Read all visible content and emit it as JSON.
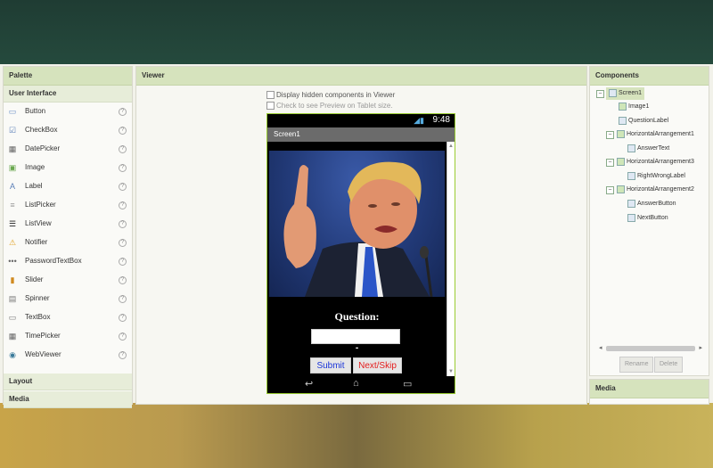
{
  "palette": {
    "header": "Palette",
    "section_user_interface": "User Interface",
    "items": [
      {
        "label": "Button",
        "icon": "button-icon",
        "glyph": "▭",
        "color": "#6a8fc7"
      },
      {
        "label": "CheckBox",
        "icon": "checkbox-icon",
        "glyph": "☑",
        "color": "#5a7fb7"
      },
      {
        "label": "DatePicker",
        "icon": "datepicker-icon",
        "glyph": "▦",
        "color": "#666"
      },
      {
        "label": "Image",
        "icon": "image-icon",
        "glyph": "▣",
        "color": "#6aa84f"
      },
      {
        "label": "Label",
        "icon": "label-icon",
        "glyph": "A",
        "color": "#5a7fb7"
      },
      {
        "label": "ListPicker",
        "icon": "listpicker-icon",
        "glyph": "≡",
        "color": "#999"
      },
      {
        "label": "ListView",
        "icon": "listview-icon",
        "glyph": "☰",
        "color": "#222"
      },
      {
        "label": "Notifier",
        "icon": "notifier-icon",
        "glyph": "⚠",
        "color": "#e0a020"
      },
      {
        "label": "PasswordTextBox",
        "icon": "password-icon",
        "glyph": "•••",
        "color": "#666"
      },
      {
        "label": "Slider",
        "icon": "slider-icon",
        "glyph": "▮",
        "color": "#d08a20"
      },
      {
        "label": "Spinner",
        "icon": "spinner-icon",
        "glyph": "▤",
        "color": "#777"
      },
      {
        "label": "TextBox",
        "icon": "textbox-icon",
        "glyph": "▭",
        "color": "#777"
      },
      {
        "label": "TimePicker",
        "icon": "timepicker-icon",
        "glyph": "▦",
        "color": "#666"
      },
      {
        "label": "WebViewer",
        "icon": "webviewer-icon",
        "glyph": "◉",
        "color": "#3a7a9a"
      }
    ],
    "section_layout": "Layout",
    "section_media": "Media"
  },
  "viewer": {
    "header": "Viewer",
    "display_hidden": "Display hidden components in Viewer",
    "tablet_preview": "Check to see Preview on Tablet size."
  },
  "phone": {
    "time": "9:48",
    "screen_title": "Screen1",
    "question_label": "Question:",
    "answer_value": "",
    "right_wrong_label": "-",
    "submit_label": "Submit",
    "next_label": "Next/Skip"
  },
  "components": {
    "header": "Components",
    "tree": [
      {
        "label": "Screen1",
        "icon": "screen-icon"
      },
      {
        "label": "Image1",
        "icon": "image-icon"
      },
      {
        "label": "QuestionLabel",
        "icon": "label-icon"
      },
      {
        "label": "HorizontalArrangement1",
        "icon": "arrangement-icon"
      },
      {
        "label": "AnswerText",
        "icon": "textbox-icon"
      },
      {
        "label": "HorizontalArrangement3",
        "icon": "arrangement-icon"
      },
      {
        "label": "RightWrongLabel",
        "icon": "label-icon"
      },
      {
        "label": "HorizontalArrangement2",
        "icon": "arrangement-icon"
      },
      {
        "label": "AnswerButton",
        "icon": "button-icon"
      },
      {
        "label": "NextButton",
        "icon": "button-icon"
      }
    ],
    "rename_label": "Rename",
    "delete_label": "Delete",
    "media_header": "Media"
  }
}
